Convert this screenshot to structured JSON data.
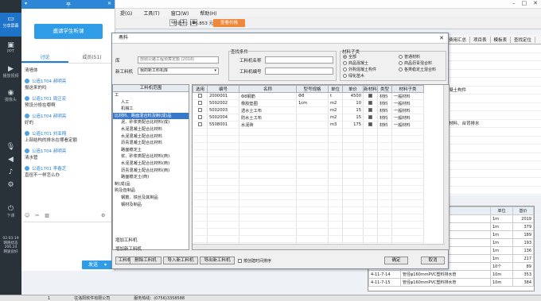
{
  "app": {
    "menu": [
      "提(G)",
      "工具(T)",
      "窗口(W)",
      "帮助(H)"
    ],
    "toolbar_icons": [
      "print-icon",
      "sigma-icon",
      "calculator-icon"
    ],
    "price_text": "总造价: 146.853 元",
    "orange_button": "查看价格",
    "right_tabs": [
      "费用汇总",
      "项目表",
      "模板表",
      "查找定位"
    ],
    "right_rows": [
      "",
      "",
      "",
      "",
      "",
      "凝土构件",
      "",
      "",
      "",
      "材料、台背排水",
      "",
      "",
      "",
      "",
      "",
      "",
      "",
      "",
      "",
      "",
      "",
      "",
      "",
      "",
      ""
    ],
    "bottom_rows": [
      {
        "col1": "",
        "col2": "排水管",
        "unit": "1m",
        "price": "2019"
      },
      {
        "col1": "",
        "col2": "排水",
        "unit": "1m",
        "price": "379"
      },
      {
        "col1": "",
        "col2": "",
        "unit": "1m",
        "price": "189"
      },
      {
        "col1": "",
        "col2": "",
        "unit": "1m",
        "price": "193"
      },
      {
        "col1": "",
        "col2": "料排水管",
        "unit": "1m",
        "price": "136"
      },
      {
        "col1": "",
        "col2": "排水管",
        "unit": "1m",
        "price": "217"
      },
      {
        "col1": "",
        "col2": "塑料排水管",
        "unit": "10个",
        "price": "89"
      },
      {
        "col1": "4-11-7-14",
        "col2": "管径φ160mmPVC塑料排水管",
        "unit": "10m",
        "price": "353"
      },
      {
        "col1": "4-11-7-15",
        "col2": "管径φ160mmPVC塑料排水管",
        "unit": "10m",
        "price": "384"
      }
    ],
    "bottom_headers": [
      "",
      "",
      "单位",
      "基价"
    ],
    "status": [
      "1",
      "往洛阳软件有限公司",
      "服务热线：(0756)3358588"
    ]
  },
  "rail": {
    "share_label": "分享屏幕",
    "items": [
      "PPT",
      "播放视频",
      "摄像头"
    ],
    "bottom_label": "下课",
    "time": "02:03:19",
    "net_label": "网络状态",
    "net_value": "206.24",
    "net_state": "网速良好"
  },
  "chat": {
    "header_right": "平",
    "invite_button": "邀请学生听课",
    "tab_discuss": "讨论",
    "tab_members": "成员(51)",
    "messages": [
      {
        "user": "",
        "text": "清墙体"
      },
      {
        "user": "公造1704 郝明亮",
        "text": "报这来的吗"
      },
      {
        "user": "公造1701 周正宏",
        "text": "预设分修在哪啊"
      },
      {
        "user": "公造1704 郝明亮",
        "text": "好的"
      },
      {
        "user": "公造1701 刘亚翔",
        "text": "上部结构的排水在哪看定额"
      },
      {
        "user": "公造1704 郝明亮",
        "text": "清水管"
      },
      {
        "user": "公造1701 李春芝",
        "text": "直徑不一样怎么办"
      }
    ],
    "send_label": "发送",
    "tools": [
      "emoji-icon",
      "scissors-icon",
      "image-icon",
      "settings-icon"
    ]
  },
  "dialog": {
    "title": "甬料",
    "lib_label": "库",
    "lib_value": "部颁公路工程预算定额 (2018)",
    "new_lib_label": "新工料机",
    "new_lib_value": "我的新工料机库",
    "query_label": "查找条件",
    "name_label": "工料机名称",
    "code_label": "工料机编号",
    "material_group": "材料子类",
    "radios": [
      "全部",
      "普通材料",
      "商品混凝土",
      "商品沥青混合料",
      "外购混凝土构件",
      "各类稳定土混合料",
      "绿化苗木"
    ],
    "tree_header": "工料机范围",
    "tree_rows": [
      "工",
      "人工",
      "机械工",
      "比材料、路面混合料及制(成)品",
      "泥、砂浆类配合比材料(成)",
      "水泥混凝土配合比材料",
      "水泥混凝土配合比材料",
      "沥青混凝土配合比材料",
      "路面稳定土",
      "浆、砂浆类配合比材料(商)",
      "水泥混凝土配合比材料(商)",
      "沥青混凝土配合比材料(商)",
      "路面稳定土(商)",
      "制(成)品",
      "购及自制品",
      "钢筋、铁丝及其制品",
      "钢材及制品",
      "",
      "",
      "",
      "",
      "",
      "",
      ""
    ],
    "grid_headers": [
      "选用",
      "编号",
      "名称",
      "型号规格",
      "单位",
      "单价",
      "新材料",
      "类型",
      "材料子类"
    ],
    "grid_rows": [
      {
        "check": false,
        "code": "2000001",
        "name": "Φ8钢筋",
        "spec": "Φ8",
        "unit": "t",
        "price": "4500",
        "new": true,
        "type": "材料",
        "sub": "一般材料"
      },
      {
        "check": false,
        "code": "5002002",
        "name": "橡胶垫圈",
        "spec": "1cm",
        "unit": "m2",
        "price": "10",
        "new": true,
        "type": "材料",
        "sub": "一般材料"
      },
      {
        "check": false,
        "code": "5002003",
        "name": "透水土工布",
        "spec": "",
        "unit": "m2",
        "price": "15",
        "new": true,
        "type": "材料",
        "sub": "一般材料"
      },
      {
        "check": false,
        "code": "5002004",
        "name": "防水土工布",
        "spec": "",
        "unit": "m2",
        "price": "15",
        "new": true,
        "type": "材料",
        "sub": "一般材料"
      },
      {
        "check": false,
        "code": "5508001",
        "name": "水泥砖",
        "spec": "",
        "unit": "m3",
        "price": "175",
        "new": true,
        "type": "材料",
        "sub": "一般材料"
      }
    ],
    "buttons": [
      "工料机",
      "删除工料机",
      "导入新工料机",
      "导出新工料机"
    ],
    "sort_label": "按创建时间排序",
    "add_label": "增加工料机",
    "add_new_label": "增加新工料机",
    "ok": "确定",
    "cancel": "取消"
  }
}
